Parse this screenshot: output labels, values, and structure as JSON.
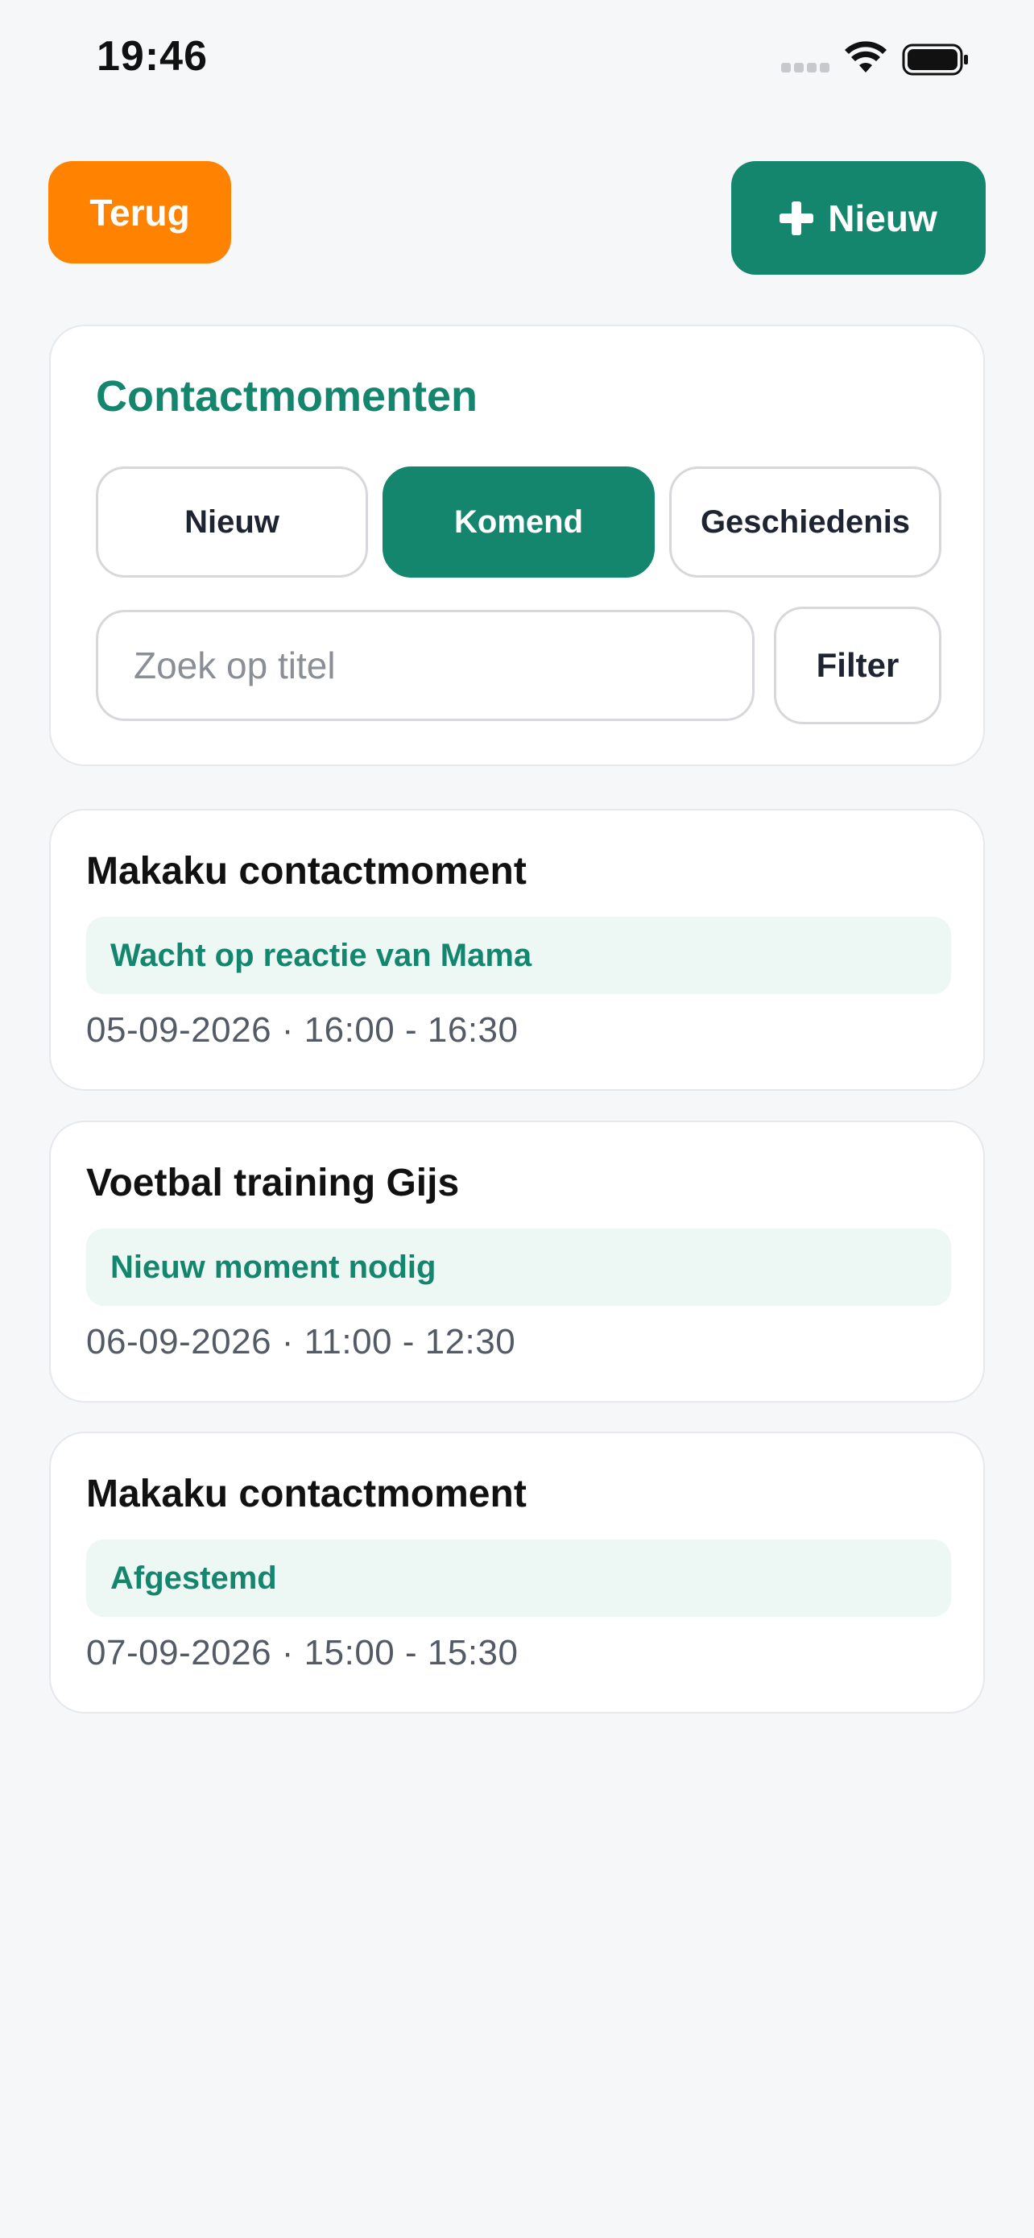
{
  "status_bar": {
    "time": "19:46",
    "icons": [
      "signal-icon",
      "wifi-icon",
      "battery-icon"
    ]
  },
  "toolbar": {
    "back_label": "Terug",
    "new_label": "Nieuw",
    "new_icon": "plus-icon"
  },
  "header": {
    "title": "Contactmomenten",
    "tabs": [
      {
        "label": "Nieuw",
        "active": false
      },
      {
        "label": "Komend",
        "active": true
      },
      {
        "label": "Geschiedenis",
        "active": false
      }
    ],
    "search": {
      "value": "",
      "placeholder": "Zoek op titel"
    },
    "filter_label": "Filter"
  },
  "appointments": [
    {
      "title": "Makaku contactmoment",
      "status": "Wacht op reactie van Mama",
      "time": "05-09-2026 · 16:00 - 16:30"
    },
    {
      "title": "Voetbal training Gijs",
      "status": "Nieuw moment nodig",
      "time": "06-09-2026 · 11:00 - 12:30"
    },
    {
      "title": "Makaku contactmoment",
      "status": "Afgestemd",
      "time": "07-09-2026 · 15:00 - 15:30"
    }
  ],
  "colors": {
    "primary": "#14866e",
    "back_button": "#ff8200",
    "status_background": "#edf7f3",
    "page_background": "#f6f7f9"
  }
}
